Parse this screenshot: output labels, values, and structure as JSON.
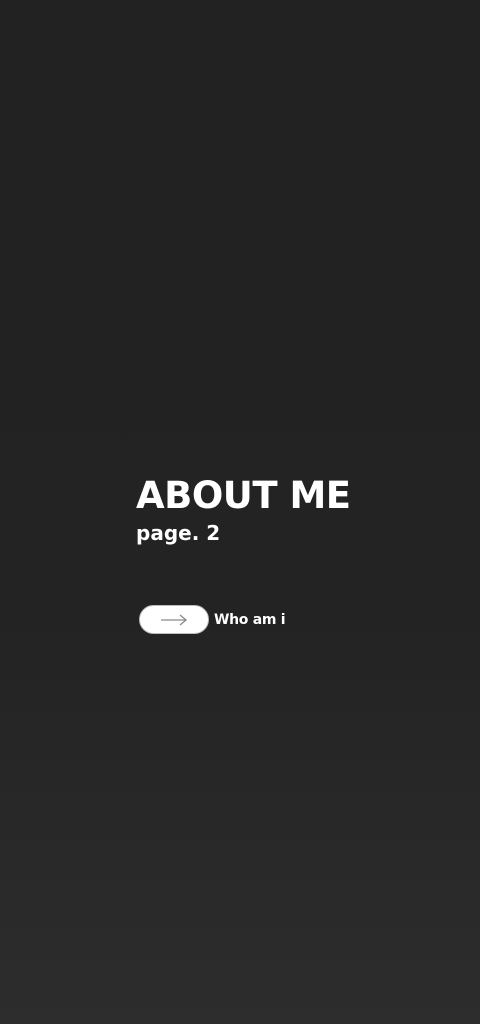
{
  "hero": {
    "title": "ABOUT ME",
    "subtitle": "page. 2"
  },
  "cta": {
    "label": "Who am i",
    "icon": "arrow-right-icon"
  },
  "colors": {
    "background_top": "#222222",
    "background_bottom": "#2d2d2d",
    "text": "#ffffff",
    "pill": "#ffffff",
    "arrow": "#8a8a8a"
  }
}
